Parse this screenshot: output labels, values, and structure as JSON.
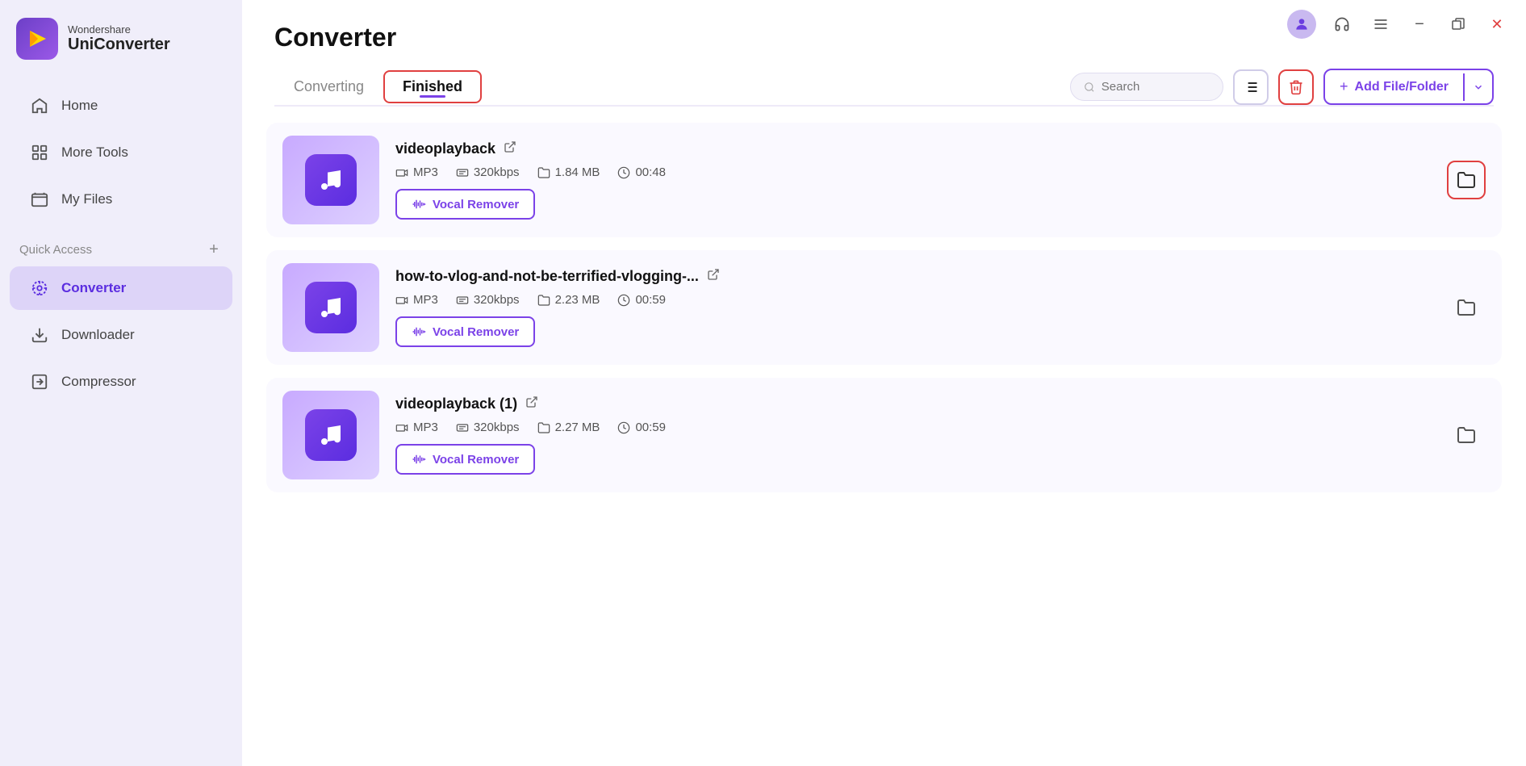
{
  "app": {
    "brand_top": "Wondershare",
    "brand_bottom": "UniConverter"
  },
  "sidebar": {
    "nav_items": [
      {
        "id": "home",
        "label": "Home",
        "icon": "home"
      },
      {
        "id": "more-tools",
        "label": "More Tools",
        "icon": "more-tools"
      },
      {
        "id": "my-files",
        "label": "My Files",
        "icon": "my-files"
      }
    ],
    "quick_access_label": "Quick Access",
    "quick_access_icon": "+",
    "converter_label": "Converter",
    "downloader_label": "Downloader",
    "compressor_label": "Compressor"
  },
  "header": {
    "page_title": "Converter",
    "tabs": [
      {
        "id": "converting",
        "label": "Converting",
        "active": false
      },
      {
        "id": "finished",
        "label": "Finished",
        "active": true
      }
    ],
    "search_placeholder": "Search",
    "add_file_label": "Add File/Folder"
  },
  "files": [
    {
      "name": "videoplayback",
      "format": "MP3",
      "bitrate": "320kbps",
      "size": "1.84 MB",
      "duration": "00:48",
      "vocal_remover_label": "Vocal Remover",
      "folder_highlighted": true
    },
    {
      "name": "how-to-vlog-and-not-be-terrified-vlogging-...",
      "format": "MP3",
      "bitrate": "320kbps",
      "size": "2.23 MB",
      "duration": "00:59",
      "vocal_remover_label": "Vocal Remover",
      "folder_highlighted": false
    },
    {
      "name": "videoplayback (1)",
      "format": "MP3",
      "bitrate": "320kbps",
      "size": "2.27 MB",
      "duration": "00:59",
      "vocal_remover_label": "Vocal Remover",
      "folder_highlighted": false
    }
  ]
}
